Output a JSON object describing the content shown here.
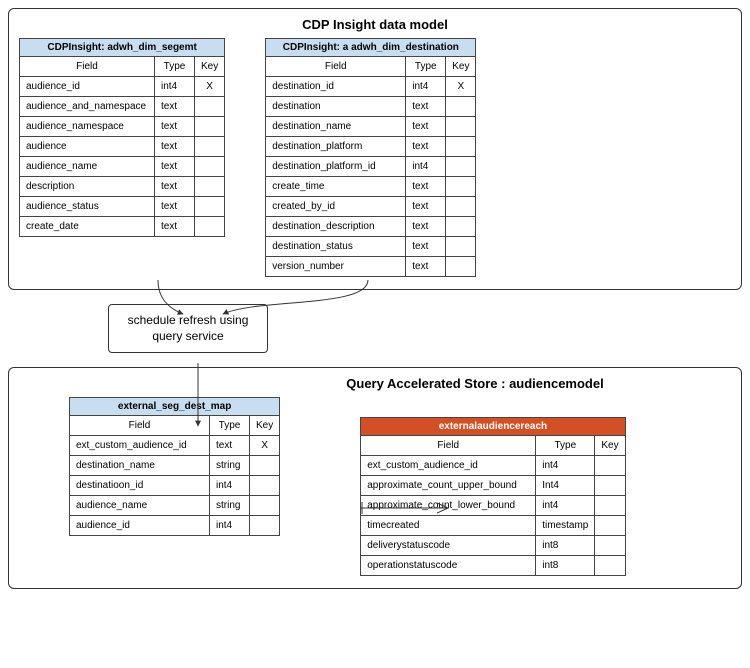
{
  "topContainer": {
    "title": "CDP Insight data model"
  },
  "bottomContainer": {
    "title": "Query Accelerated Store : audiencemodel"
  },
  "process": {
    "label_line1": "schedule refresh using",
    "label_line2": "query service"
  },
  "headers": {
    "field": "Field",
    "type": "Type",
    "key": "Key"
  },
  "table_segment": {
    "title": "CDPInsight: adwh_dim_segemt",
    "rows": [
      {
        "field": "audience_id",
        "type": "int4",
        "key": "X"
      },
      {
        "field": "audience_and_namespace",
        "type": "text",
        "key": ""
      },
      {
        "field": "audience_namespace",
        "type": "text",
        "key": ""
      },
      {
        "field": "audience",
        "type": "text",
        "key": ""
      },
      {
        "field": "audience_name",
        "type": "text",
        "key": ""
      },
      {
        "field": "description",
        "type": "text",
        "key": ""
      },
      {
        "field": "audience_status",
        "type": "text",
        "key": ""
      },
      {
        "field": "create_date",
        "type": "text",
        "key": ""
      }
    ]
  },
  "table_destination": {
    "title": "CDPInsight: a adwh_dim_destination",
    "rows": [
      {
        "field": "destination_id",
        "type": "int4",
        "key": "X"
      },
      {
        "field": "destination",
        "type": "text",
        "key": ""
      },
      {
        "field": "destination_name",
        "type": "text",
        "key": ""
      },
      {
        "field": "destination_platform",
        "type": "text",
        "key": ""
      },
      {
        "field": "destination_platform_id",
        "type": "int4",
        "key": ""
      },
      {
        "field": "create_time",
        "type": "text",
        "key": ""
      },
      {
        "field": "created_by_id",
        "type": "text",
        "key": ""
      },
      {
        "field": "destination_description",
        "type": "text",
        "key": ""
      },
      {
        "field": "destination_status",
        "type": "text",
        "key": ""
      },
      {
        "field": "version_number",
        "type": "text",
        "key": ""
      }
    ]
  },
  "table_map": {
    "title": "external_seg_dest_map",
    "rows": [
      {
        "field": "ext_custom_audience_id",
        "type": "text",
        "key": "X"
      },
      {
        "field": "destination_name",
        "type": "string",
        "key": ""
      },
      {
        "field": "destinatioon_id",
        "type": "int4",
        "key": ""
      },
      {
        "field": "audience_name",
        "type": "string",
        "key": ""
      },
      {
        "field": "audience_id",
        "type": "int4",
        "key": ""
      }
    ]
  },
  "table_reach": {
    "title": "externalaudiencereach",
    "rows": [
      {
        "field": "ext_custom_audience_id",
        "type": "int4",
        "key": ""
      },
      {
        "field": "approximate_count_upper_bound",
        "type": "Int4",
        "key": ""
      },
      {
        "field": "approximate_count_lower_bound",
        "type": "int4",
        "key": ""
      },
      {
        "field": "timecreated",
        "type": "timestamp",
        "key": ""
      },
      {
        "field": "deliverystatuscode",
        "type": "int8",
        "key": ""
      },
      {
        "field": "operationstatuscode",
        "type": "int8",
        "key": ""
      }
    ]
  }
}
